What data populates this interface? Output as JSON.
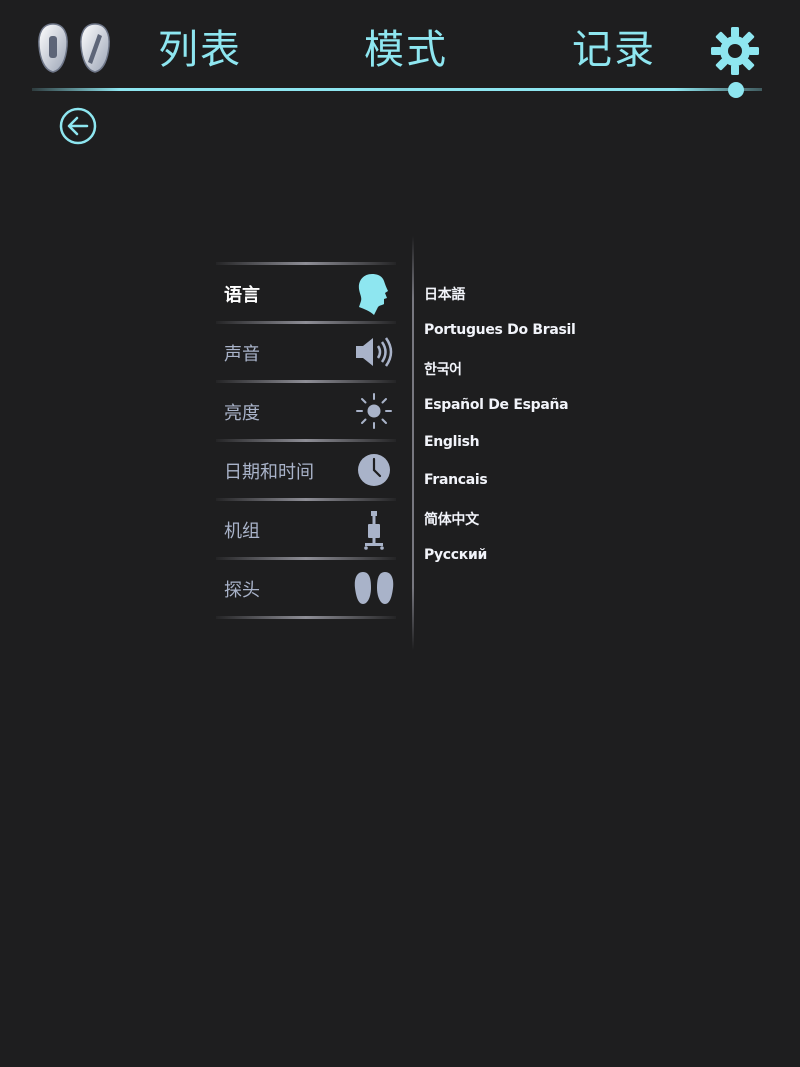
{
  "header": {
    "tabs": [
      {
        "label": "列表"
      },
      {
        "label": "模式"
      },
      {
        "label": "记录"
      }
    ],
    "icons": {
      "probes": "probe-pair-icon",
      "settings": "gear-icon",
      "back": "back-arrow-icon"
    },
    "accent_color": "#8ee6f0"
  },
  "settings_menu": {
    "items": [
      {
        "label": "语言",
        "icon": "head-profile-icon",
        "active": true
      },
      {
        "label": "声音",
        "icon": "speaker-icon",
        "active": false
      },
      {
        "label": "亮度",
        "icon": "brightness-icon",
        "active": false
      },
      {
        "label": "日期和时间",
        "icon": "clock-icon",
        "active": false
      },
      {
        "label": "机组",
        "icon": "cart-unit-icon",
        "active": false
      },
      {
        "label": "探头",
        "icon": "probe-icon",
        "active": false
      }
    ]
  },
  "languages": [
    "日本語",
    "Portugues Do Brasil",
    "한국어",
    "Español De España",
    "English",
    "Francais",
    "简体中文",
    "Русский"
  ]
}
